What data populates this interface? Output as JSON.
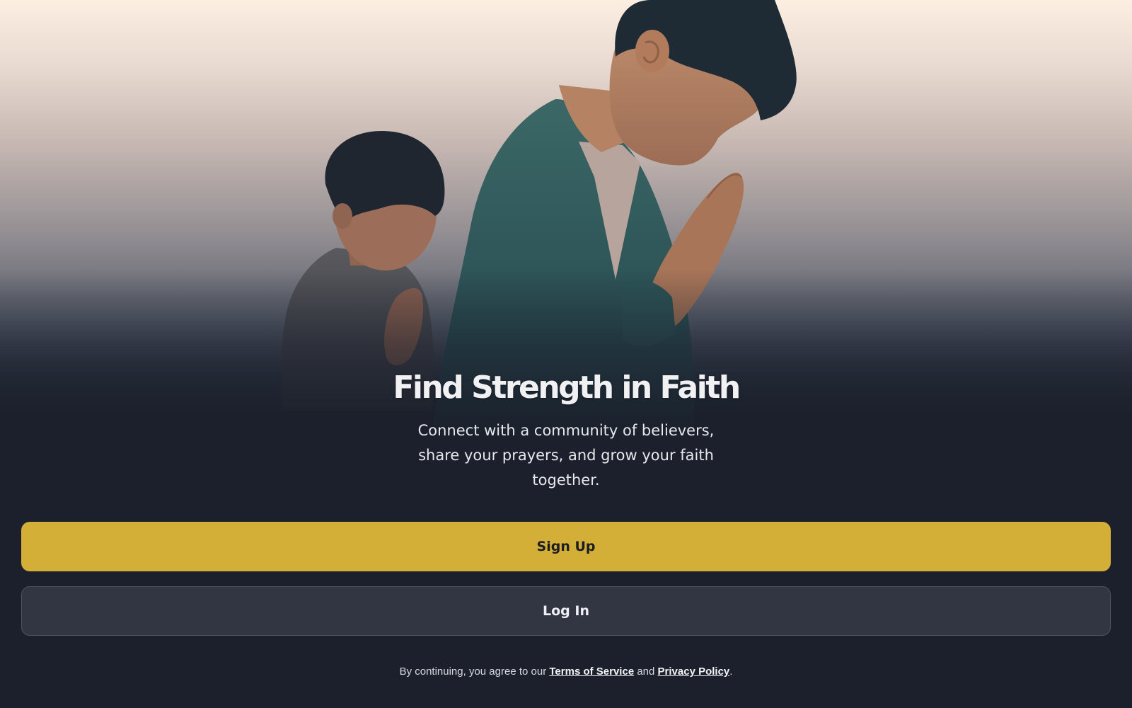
{
  "hero": {
    "headline": "Find Strength in Faith",
    "subtitle_lines": [
      "Connect with a community of believers,",
      "share your prayers, and grow your faith",
      "together."
    ]
  },
  "actions": {
    "signup_label": "Sign Up",
    "login_label": "Log In"
  },
  "legal": {
    "prefix": "By continuing, you agree to our ",
    "terms_label": "Terms of Service",
    "and": " and ",
    "privacy_label": "Privacy Policy",
    "suffix": "."
  },
  "colors": {
    "background": "#1b202c",
    "accent": "#d3af37",
    "secondary_button": "#323643"
  },
  "illustration": {
    "subject": "adult and child praying with hands folded"
  }
}
